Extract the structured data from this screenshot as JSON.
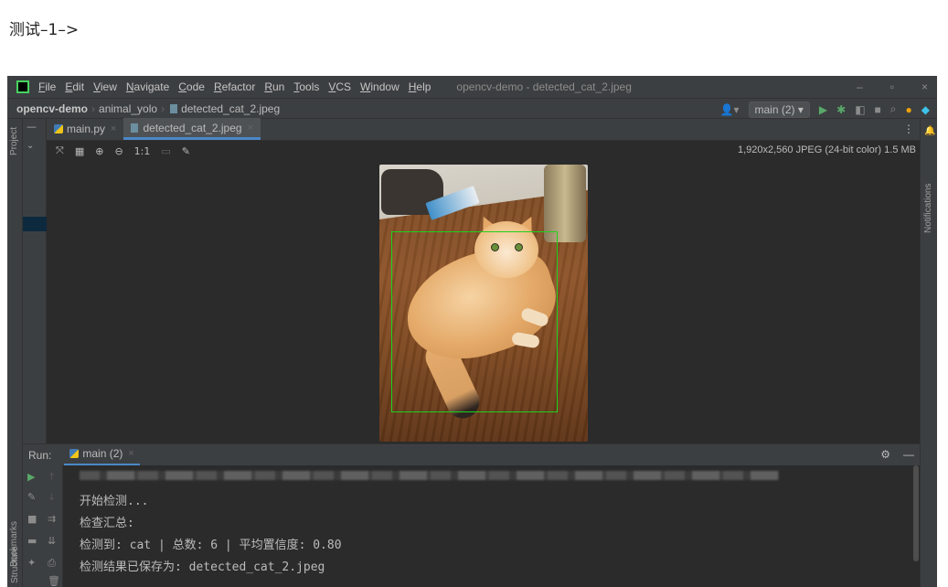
{
  "page_heading": "测试–1–>",
  "ide": {
    "menu": [
      "File",
      "Edit",
      "View",
      "Navigate",
      "Code",
      "Refactor",
      "Run",
      "Tools",
      "VCS",
      "Window",
      "Help"
    ],
    "window_title": "opencv-demo - detected_cat_2.jpeg",
    "window_controls": {
      "minimize": "–",
      "restore": "▫",
      "close": "×"
    },
    "breadcrumb": {
      "project": "opencv-demo",
      "folder": "animal_yolo",
      "file": "detected_cat_2.jpeg"
    },
    "run_config": "main (2) ▾",
    "tabs": [
      {
        "label": "main.py",
        "close": "×"
      },
      {
        "label": "detected_cat_2.jpeg",
        "close": "×"
      }
    ],
    "viewer": {
      "info": "1,920x2,560 JPEG (24-bit color) 1.5 MB",
      "zoom_actual": "1:1"
    },
    "left_strip": {
      "project": "Project",
      "bookmarks": "Bookmarks",
      "structure": "Structure"
    },
    "right_strip": {
      "notifications": "Notifications"
    },
    "run_panel": {
      "label": "Run:",
      "tab": "main (2)",
      "tab_close": "×",
      "console_lines": [
        "开始检测...",
        "检查汇总:",
        "检测到: cat | 总数: 6 | 平均置信度: 0.80",
        "检测结果已保存为: detected_cat_2.jpeg"
      ]
    },
    "colors": {
      "accent": "#4a88c7",
      "bbox": "#1fd11f",
      "run_green": "#59a869"
    }
  }
}
